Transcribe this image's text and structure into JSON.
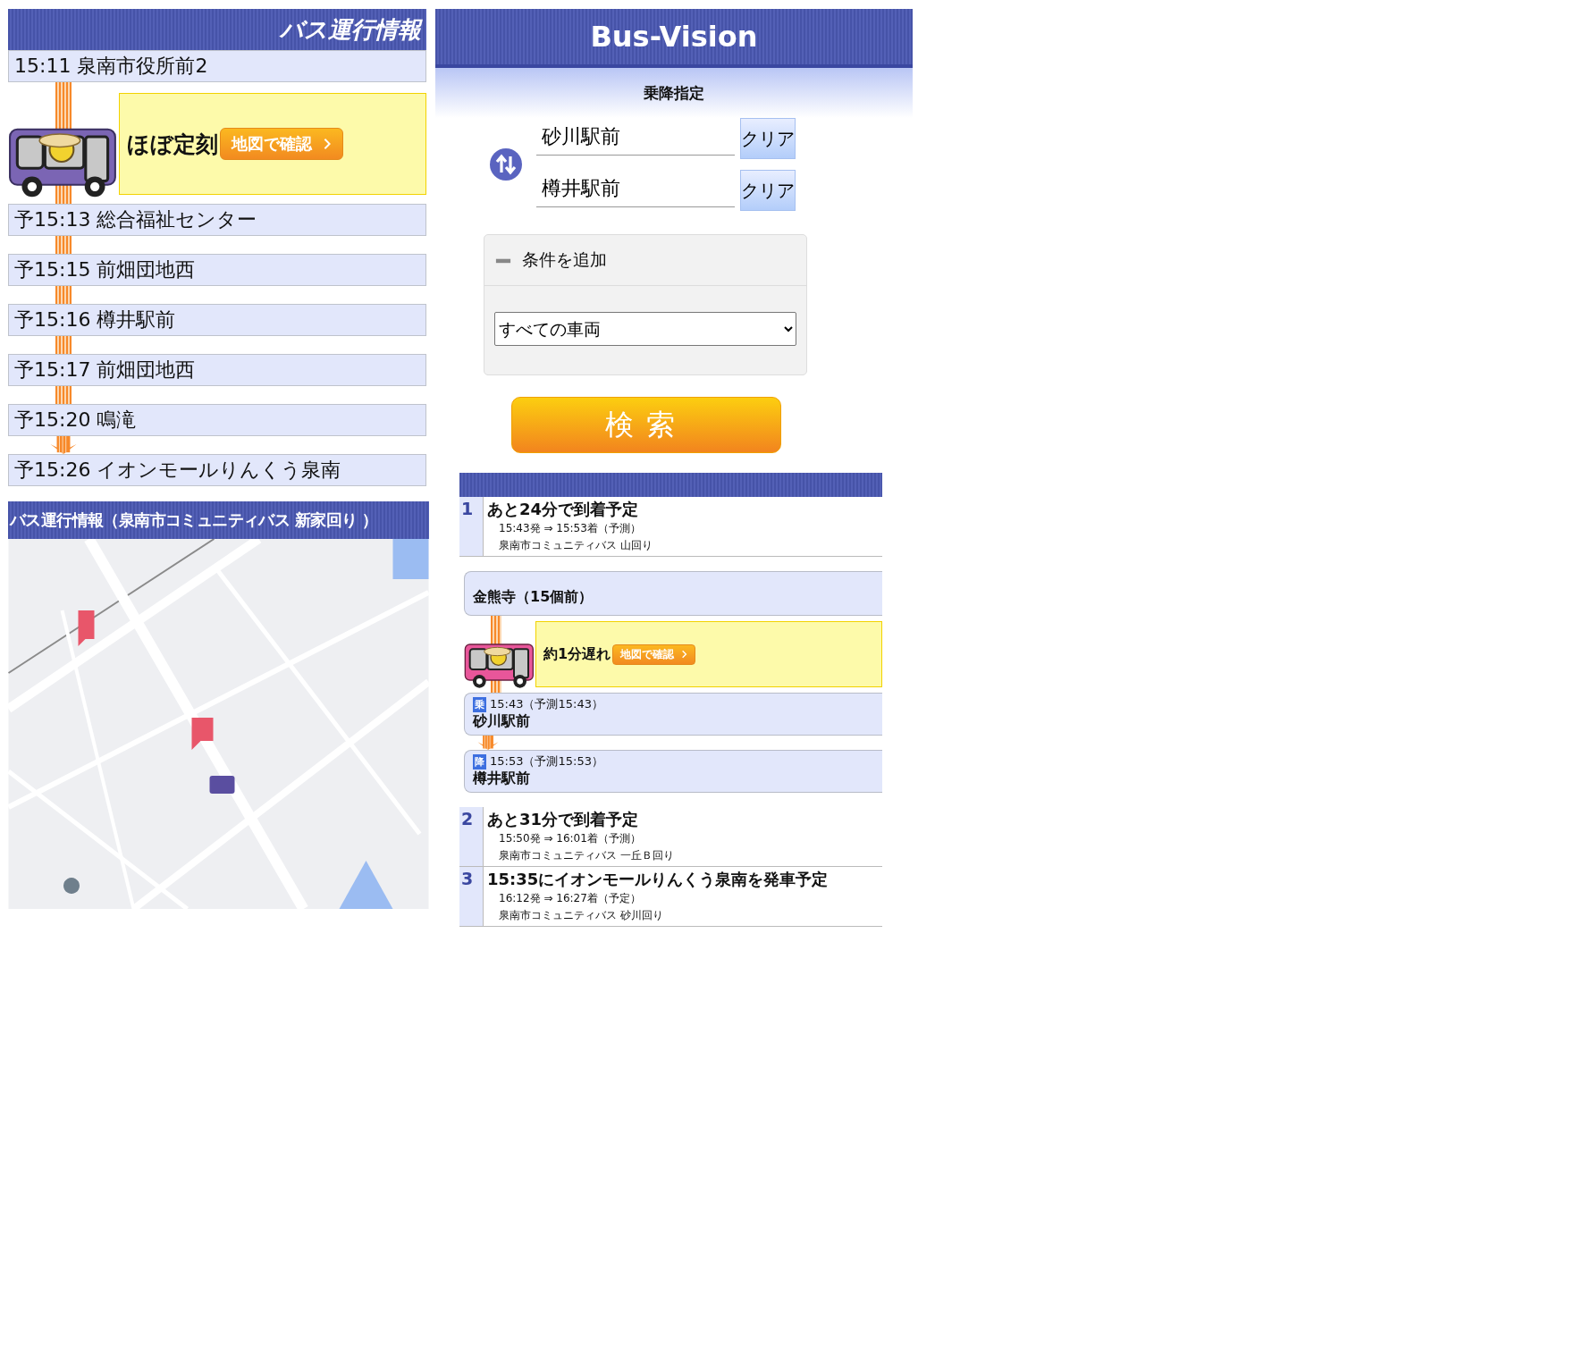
{
  "timeline_panel": {
    "title": "バス運行情報",
    "items": [
      {
        "kind": "stop",
        "text": "15:11 泉南市役所前2"
      },
      {
        "kind": "bus",
        "status": "ほぼ定刻",
        "map_button": "地図で確認"
      },
      {
        "kind": "stop",
        "text": "予15:13 総合福祉センター"
      },
      {
        "kind": "stop",
        "text": "予15:15 前畑団地西"
      },
      {
        "kind": "stop",
        "text": "予15:16 樽井駅前"
      },
      {
        "kind": "stop",
        "text": "予15:17 前畑団地西"
      },
      {
        "kind": "stop",
        "text": "予15:20 鳴滝"
      },
      {
        "kind": "stop",
        "text": "予15:26 イオンモールりんくう泉南"
      }
    ]
  },
  "map_panel": {
    "title": "バス運行情報（泉南市コミュニティバス 新家回り ）"
  },
  "app": {
    "logo": "Bus-Vision",
    "section_title": "乗降指定",
    "stops": [
      {
        "value": "砂川駅前",
        "clear": "クリア"
      },
      {
        "value": "樽井駅前",
        "clear": "クリア"
      }
    ],
    "conditions": {
      "title": "条件を追加",
      "expanded": true,
      "vehicle_select": "すべての車両"
    },
    "search_button": "検索"
  },
  "results": [
    {
      "number": "1",
      "headline": "あと24分で到着予定",
      "times": "15:43発 ⇒ 15:53着（予測）",
      "route": "泉南市コミュニティバス 山回り",
      "detail": {
        "current_stop": "金熊寺（15個前）",
        "status": "約1分遅れ",
        "map_button": "地図で確認",
        "stops": [
          {
            "badge": "乗",
            "time": "15:43（予測15:43）",
            "name": "砂川駅前"
          },
          {
            "badge": "降",
            "time": "15:53（予測15:53）",
            "name": "樽井駅前"
          }
        ]
      }
    },
    {
      "number": "2",
      "headline": "あと31分で到着予定",
      "times": "15:50発 ⇒ 16:01着（予測）",
      "route": "泉南市コミュニティバス 一丘Ｂ回り"
    },
    {
      "number": "3",
      "headline": "15:35にイオンモールりんくう泉南を発車予定",
      "times": "16:12発 ⇒ 16:27着（予定）",
      "route": "泉南市コミュニティバス 砂川回り"
    }
  ]
}
